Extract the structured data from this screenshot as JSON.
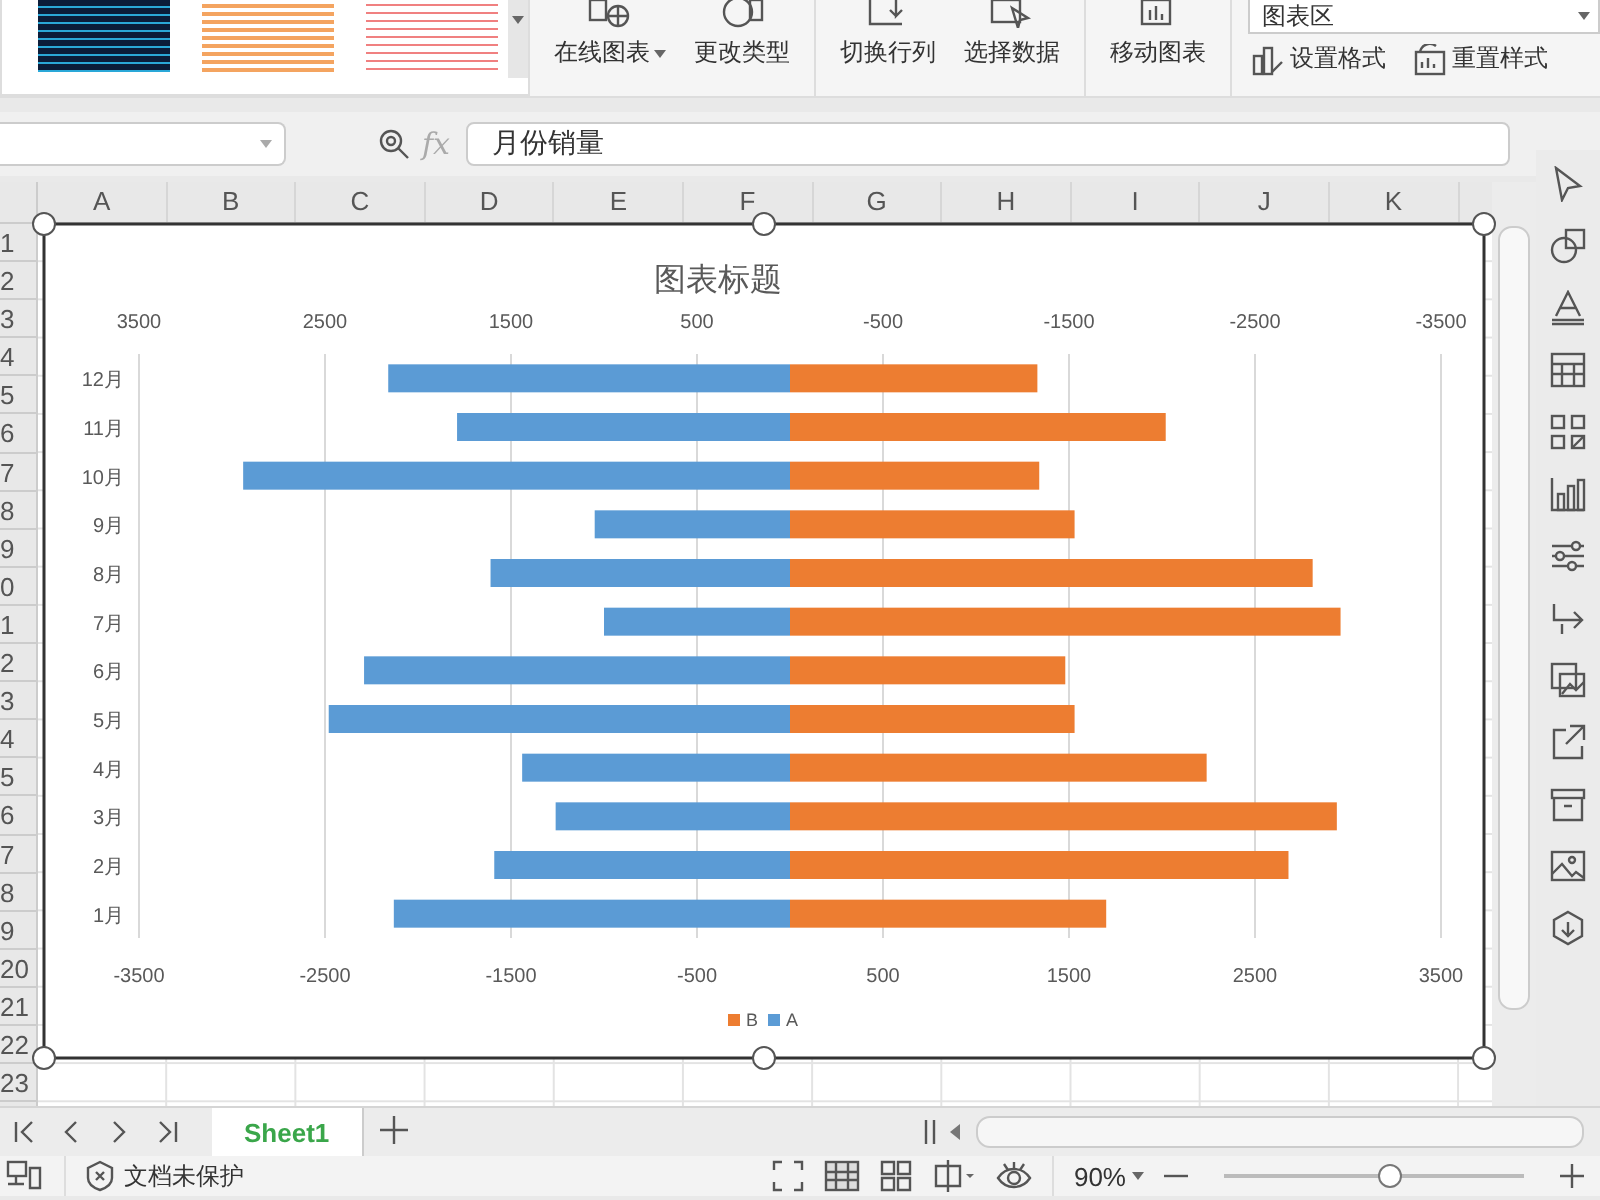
{
  "ribbon": {
    "buttons": [
      {
        "label": "在线图表",
        "caret": true
      },
      {
        "label": "更改类型",
        "caret": false
      },
      {
        "label": "切换行列",
        "caret": false
      },
      {
        "label": "选择数据",
        "caret": false
      },
      {
        "label": "移动图表",
        "caret": false
      }
    ],
    "element_dropdown": {
      "value": "图表区"
    },
    "small_buttons": [
      {
        "label": "设置格式"
      },
      {
        "label": "重置样式"
      }
    ]
  },
  "formula_bar": {
    "fx": "fx",
    "value": "月份销量"
  },
  "column_headers": [
    "A",
    "B",
    "C",
    "D",
    "E",
    "F",
    "G",
    "H",
    "I",
    "J",
    "K"
  ],
  "row_headers": [
    "1",
    "2",
    "3",
    "4",
    "5",
    "6",
    "7",
    "8",
    "9",
    "0",
    "1",
    "2",
    "3",
    "4",
    "5",
    "6",
    "7",
    "8",
    "9",
    "20",
    "21",
    "22",
    "23"
  ],
  "chart": {
    "chart_data": {
      "type": "bar",
      "orientation": "horizontal",
      "stacked": true,
      "grid": true,
      "legend": true,
      "annotations": [
        "3500",
        "2500",
        "1500",
        "500",
        "-500",
        "-1500",
        "-2500",
        "-3500"
      ],
      "title": "图表标题",
      "categories": [
        "12月",
        "11月",
        "10月",
        "9月",
        "8月",
        "7月",
        "6月",
        "5月",
        "4月",
        "3月",
        "2月",
        "1月"
      ],
      "series": [
        {
          "name": "A",
          "color": "#5b9bd5",
          "values": [
            -2160,
            -1790,
            -2940,
            -1050,
            -1610,
            -1000,
            -2290,
            -2480,
            -1440,
            -1260,
            -1590,
            -2130
          ]
        },
        {
          "name": "B",
          "color": "#ed7d31",
          "values": [
            1330,
            2020,
            1340,
            1530,
            2810,
            2960,
            1480,
            1530,
            2240,
            2940,
            2680,
            1700
          ]
        }
      ],
      "xlim": [
        -3500,
        3500
      ],
      "xticks": [
        -3500,
        -2500,
        -1500,
        -500,
        500,
        1500,
        2500,
        3500
      ]
    }
  },
  "sheet_tabs": [
    {
      "label": "Sheet1",
      "selected": true
    }
  ],
  "status_bar": {
    "protection": "文档未保护",
    "zoom": "90%",
    "zoom_slider": {
      "level": 0.55
    }
  }
}
